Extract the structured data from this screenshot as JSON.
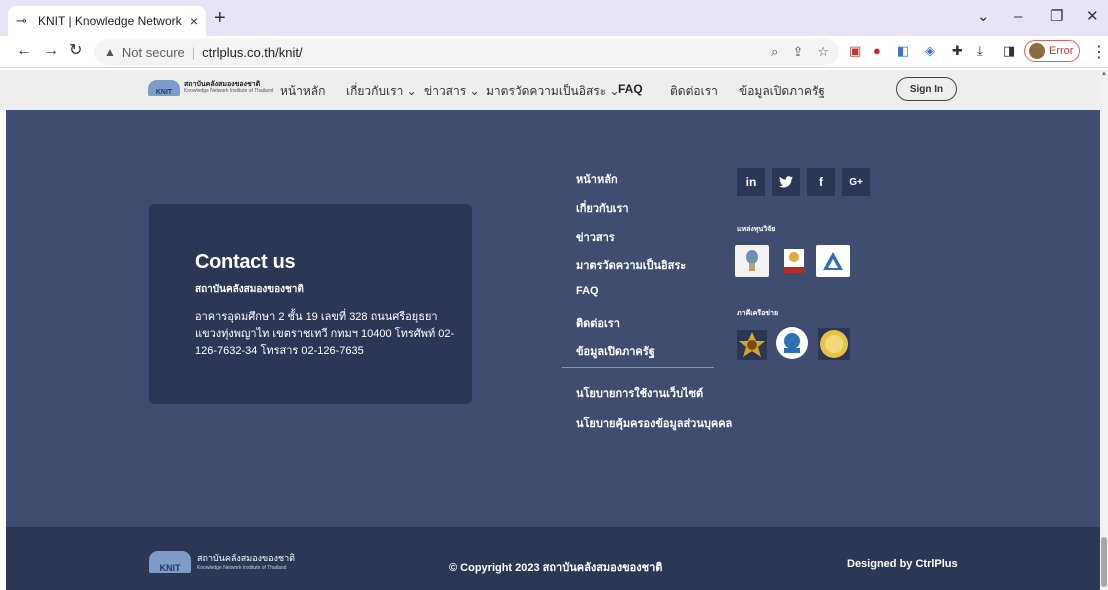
{
  "browser": {
    "tab_title": "KNIT | Knowledge Network Instit",
    "tab_close": "×",
    "new_tab": "+",
    "not_secure": "Not secure",
    "url": "ctrlplus.co.th/knit/",
    "error_label": "Error"
  },
  "header": {
    "logo_th": "สถาบันคลังสมองของชาติ",
    "logo_en": "Knowledge Network Institute of Thailand",
    "logo_mark": "KNIT",
    "nav": {
      "home": "หน้าหลัก",
      "about": "เกี่ยวกับเรา",
      "news": "ข่าวสาร",
      "standard": "มาตรวัดความเป็นอิสระ",
      "faq": "FAQ",
      "contact": "ติดต่อเรา",
      "opendata": "ข้อมูลเปิดภาครัฐ"
    },
    "signin": "Sign In"
  },
  "contact": {
    "title": "Contact us",
    "org": "สถาบันคลังสมองของชาติ",
    "address": "อาคารอุดมศึกษา 2 ชั้น 19 เลขที่ 328 ถนนศรีอยุธยา แขวงทุ่งพญาไท เขตราชเทวี กทมฯ 10400 โทรศัพท์ 02-126-7632-34 โทรสาร 02-126-7635"
  },
  "footer_links": {
    "home": "หน้าหลัก",
    "about": "เกี่ยวกับเรา",
    "news": "ข่าวสาร",
    "standard": "มาตรวัดความเป็นอิสระ",
    "faq": "FAQ",
    "contact": "ติดต่อเรา",
    "opendata": "ข้อมูลเปิดภาครัฐ",
    "website_policy": "นโยบายการใช้งานเว็บไซต์",
    "privacy_policy": "นโยบายคุ้มครองข้อมูลส่วนบุคคล"
  },
  "social": {
    "linkedin": "in",
    "twitter": "twitter-icon",
    "facebook": "f",
    "google": "G+"
  },
  "sections": {
    "funding": "แหล่งทุนวิจัย",
    "partners": "ภาคีเครือข่าย"
  },
  "bottom": {
    "logo_th": "สถาบันคลังสมองของชาติ",
    "logo_en": "Knowledge Network Institute of Thailand",
    "copyright": "© Copyright 2023 สถาบันคลังสมองของชาติ",
    "designed": "Designed by CtrlPlus"
  },
  "colors": {
    "footer_bg": "#404d71",
    "footer_dark": "#2c3756",
    "tabbar": "#e7e4f5"
  }
}
